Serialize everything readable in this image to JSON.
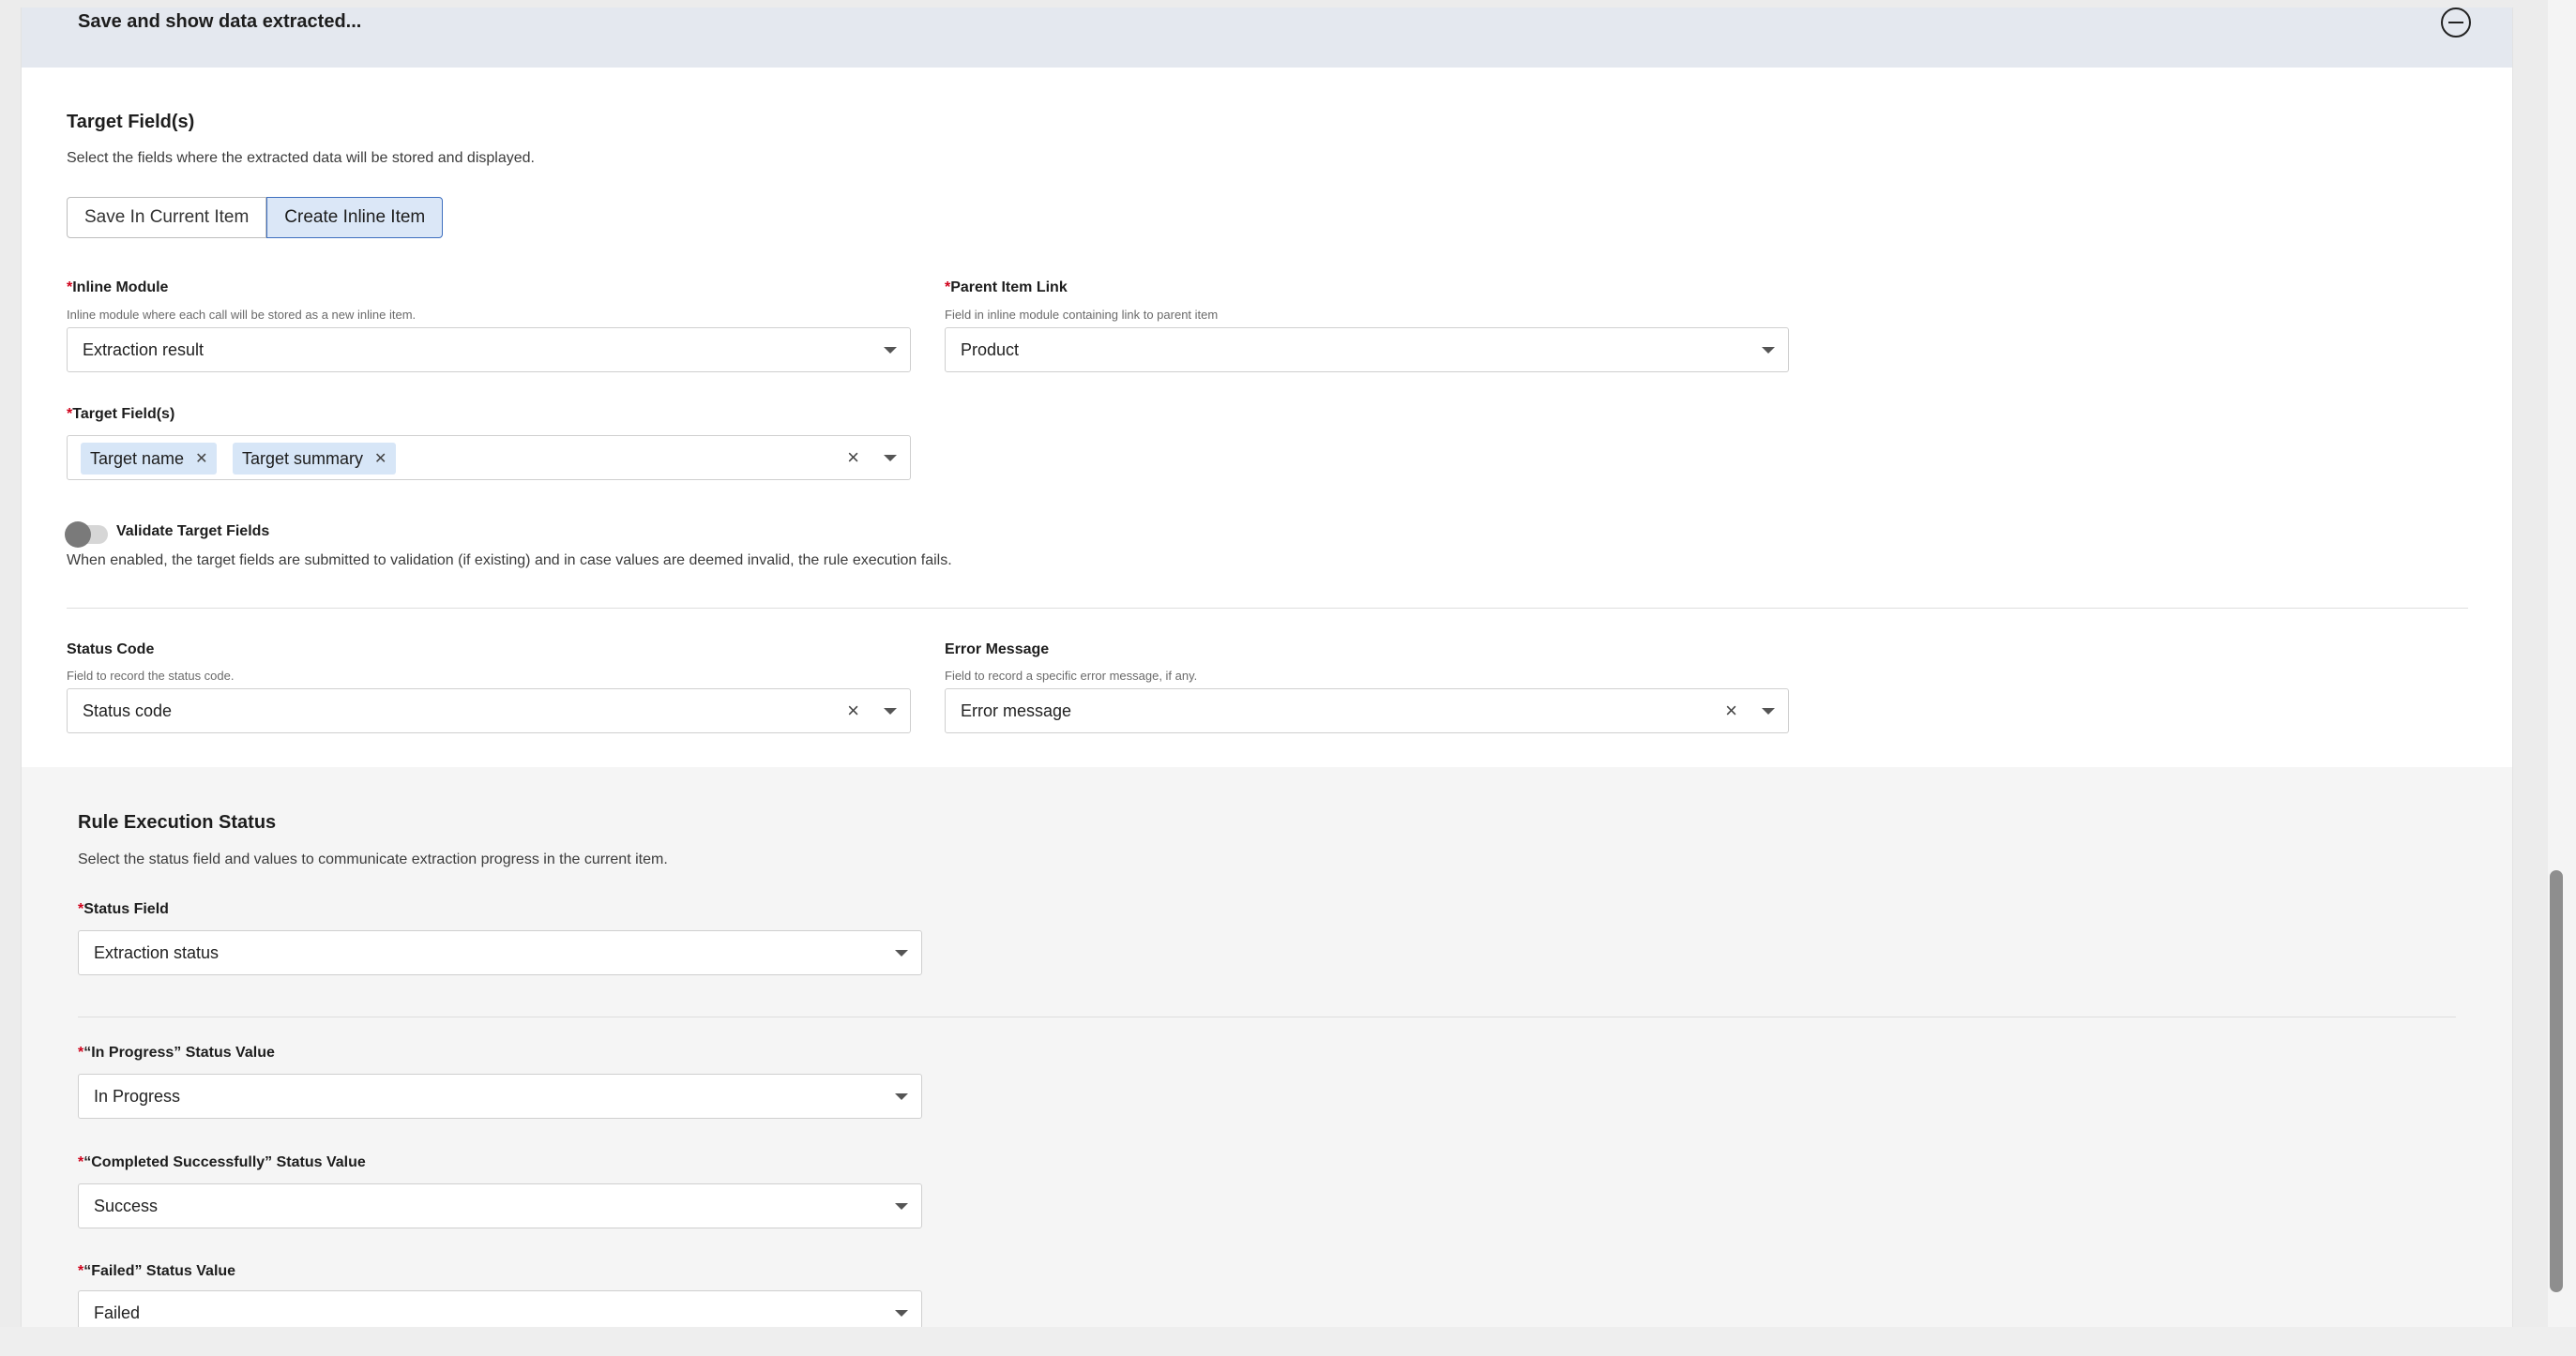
{
  "header": {
    "title": "Save and show data extracted..."
  },
  "target": {
    "title": "Target Field(s)",
    "description": "Select the fields where the extracted data will be stored and displayed.",
    "modes": {
      "current": "Save In Current Item",
      "inline": "Create Inline Item",
      "selected": "Create Inline Item"
    },
    "inline_module": {
      "required": "*",
      "label": "Inline Module",
      "help": "Inline module where each call will be stored as a new inline item.",
      "value": "Extraction result"
    },
    "parent_link": {
      "required": "*",
      "label": "Parent Item Link",
      "help": "Field in inline module containing link to parent item",
      "value": "Product"
    },
    "target_fields": {
      "required": "*",
      "label": "Target Field(s)",
      "chips": [
        "Target name",
        "Target summary"
      ]
    },
    "validate": {
      "label": "Validate Target Fields",
      "description": "When enabled, the target fields are submitted to validation (if existing) and in case values are deemed invalid, the rule execution fails.",
      "enabled": false
    },
    "status_code": {
      "label": "Status Code",
      "help": "Field to record the status code.",
      "value": "Status code"
    },
    "error_message": {
      "label": "Error Message",
      "help": "Field to record a specific error message, if any.",
      "value": "Error message"
    }
  },
  "rule_status": {
    "title": "Rule Execution Status",
    "description": "Select the status field and values to communicate extraction progress in the current item.",
    "status_field": {
      "required": "*",
      "label": "Status Field",
      "value": "Extraction status"
    },
    "in_progress": {
      "required": "*",
      "label": "“In Progress” Status Value",
      "value": "In Progress"
    },
    "completed": {
      "required": "*",
      "label": "“Completed Successfully” Status Value",
      "value": "Success"
    },
    "failed": {
      "required": "*",
      "label": "“Failed” Status Value",
      "value": "Failed"
    }
  },
  "icons": {
    "collapse": "minus-circle-icon",
    "dropdown": "caret-down-icon",
    "clear": "close-icon",
    "chip_remove": "close-icon"
  },
  "colors": {
    "accent": "#3e6fbf",
    "selected_bg": "#dbe7f7",
    "required": "#d0021b",
    "chip_bg": "#d7e6f7",
    "header_bg": "#e4e8ef"
  }
}
